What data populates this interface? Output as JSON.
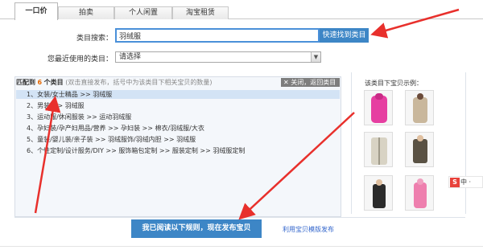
{
  "tabs": [
    {
      "label": "一口价",
      "active": true
    },
    {
      "label": "拍卖",
      "active": false
    },
    {
      "label": "个人闲置",
      "active": false
    },
    {
      "label": "淘宝租赁",
      "active": false
    }
  ],
  "search": {
    "label": "类目搜索：",
    "value": "羽绒服",
    "button": "快速找到类目"
  },
  "recent": {
    "label": "您最近使用的类目：",
    "value": "请选择"
  },
  "matches": {
    "prefix": "匹配到",
    "count": "6",
    "suffix": "个类目",
    "hint": "(双击直接发布，括号中为该类目下相关宝贝的数量)",
    "close": "关闭，返回类目",
    "items": [
      "1、女装/女士精品 >> 羽绒服",
      "2、男装 >> 羽绒服",
      "3、运动服/休闲服装 >> 运动羽绒服",
      "4、孕妇装/孕产妇用品/营养 >> 孕妇装 >> 棉衣/羽绒服/大衣",
      "5、童装/婴儿装/亲子装 >> 羽绒服饰/羽绒内胆 >> 羽绒服",
      "6、个性定制/设计服务/DIY >> 服饰箱包定制 >> 服装定制 >> 羽绒服定制"
    ]
  },
  "examples": {
    "title": "该类目下宝贝示例："
  },
  "publish": {
    "button": "我已阅读以下规则，现在发布宝贝",
    "template_link": "利用宝贝模版发布"
  },
  "widget": {
    "badge": "S",
    "text": "中 ·"
  },
  "colors": {
    "accent": "#3d86c6",
    "arrow": "#e8302c",
    "highlight_count": "#e56600"
  }
}
